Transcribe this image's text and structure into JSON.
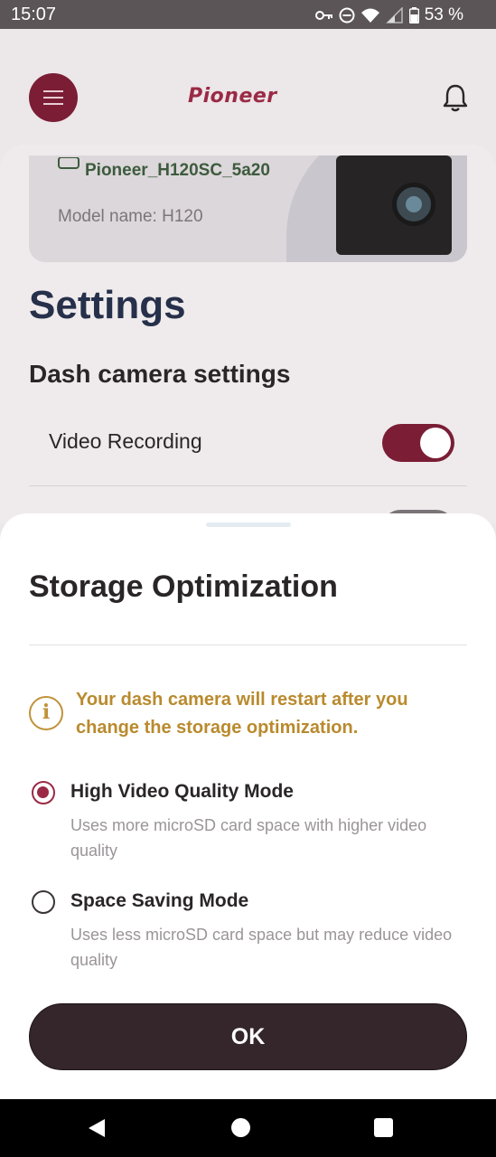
{
  "status_bar": {
    "time": "15:07",
    "battery_percent": "53 %",
    "icons": [
      "key-icon",
      "do-not-disturb-icon",
      "wifi-icon",
      "signal-icon",
      "battery-icon"
    ]
  },
  "header": {
    "logo_text": "Pioneer",
    "menu_icon": "hamburger-icon",
    "notification_icon": "bell-icon"
  },
  "device": {
    "name": "Pioneer_H120SC_5a20",
    "model": "Model name: H120"
  },
  "settings": {
    "title": "Settings",
    "section_title": "Dash camera settings",
    "rows": [
      {
        "label": "Video Recording",
        "enabled": true
      }
    ]
  },
  "sheet": {
    "title": "Storage Optimization",
    "info_text": "Your dash camera will restart after you change the storage optimization.",
    "options": [
      {
        "title": "High Video Quality Mode",
        "description": "Uses more microSD card space with higher video quality",
        "selected": true
      },
      {
        "title": "Space Saving Mode",
        "description": "Uses less microSD card space but may reduce video quality",
        "selected": false
      }
    ],
    "ok_label": "OK"
  },
  "colors": {
    "brand": "#7a1d35",
    "warning": "#c0923a",
    "button_dark": "#34262b"
  }
}
